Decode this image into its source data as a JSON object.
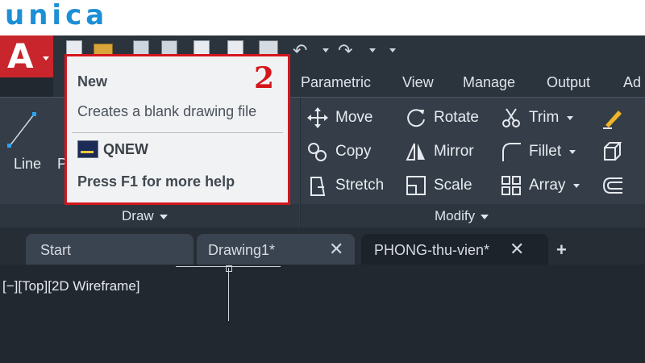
{
  "brand": {
    "logo_text": "unica"
  },
  "ribbon": {
    "tabs": [
      "Parametric",
      "View",
      "Manage",
      "Output",
      "Ad"
    ],
    "panels": {
      "draw": {
        "title": "Draw",
        "tools": [
          "Line",
          "P"
        ]
      },
      "modify": {
        "title": "Modify",
        "tools": {
          "move": "Move",
          "rotate": "Rotate",
          "trim": "Trim",
          "copy": "Copy",
          "mirror": "Mirror",
          "fillet": "Fillet",
          "stretch": "Stretch",
          "scale": "Scale",
          "array": "Array"
        }
      }
    }
  },
  "tooltip": {
    "title": "New",
    "description": "Creates a blank drawing file",
    "command": "QNEW",
    "help": "Press F1 for more help"
  },
  "step_marker": "2",
  "document_tabs": {
    "start": "Start",
    "drawing1": "Drawing1*",
    "phong": "PHONG-thu-vien*",
    "close_glyph": "✕",
    "new_tab_glyph": "+"
  },
  "viewport": {
    "label": "[−][Top][2D Wireframe]"
  },
  "colors": {
    "accent_red": "#d4161c",
    "brand_blue": "#1c8fd6",
    "app_button": "#c8262c",
    "ribbon_bg": "#343d48",
    "canvas_bg": "#212830"
  }
}
